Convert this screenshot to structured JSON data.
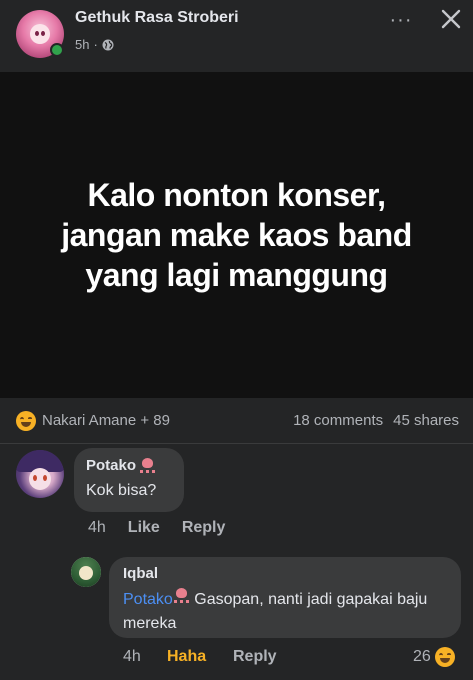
{
  "post": {
    "author": "Gethuk Rasa Stroberi",
    "time": "5h",
    "separator": "·",
    "text": "Kalo nonton konser,\njangan make kaos band\nyang lagi manggung"
  },
  "header": {
    "more_glyph": "···",
    "icons": {
      "more": "more-options-icon",
      "close": "close-icon",
      "privacy": "globe-icon"
    }
  },
  "stats": {
    "reaction_text": "Nakari Amane + 89",
    "comments": "18 comments",
    "shares": "45 shares"
  },
  "comments": [
    {
      "author": "Potako",
      "text": "Kok bisa?",
      "time": "4h",
      "like_label": "Like",
      "reply_label": "Reply",
      "replies": [
        {
          "author": "Iqbal",
          "mention": "Potako",
          "text": " Gasopan, nanti jadi gapakai baju mereka",
          "time": "4h",
          "reaction_label": "Haha",
          "reply_label": "Reply",
          "reaction_count": "26"
        }
      ]
    }
  ],
  "colors": {
    "background": "#242526",
    "post_background": "#111111",
    "bubble": "#3a3b3c",
    "mention": "#4c8ff3",
    "haha": "#f7b125",
    "online": "#31a24c"
  }
}
